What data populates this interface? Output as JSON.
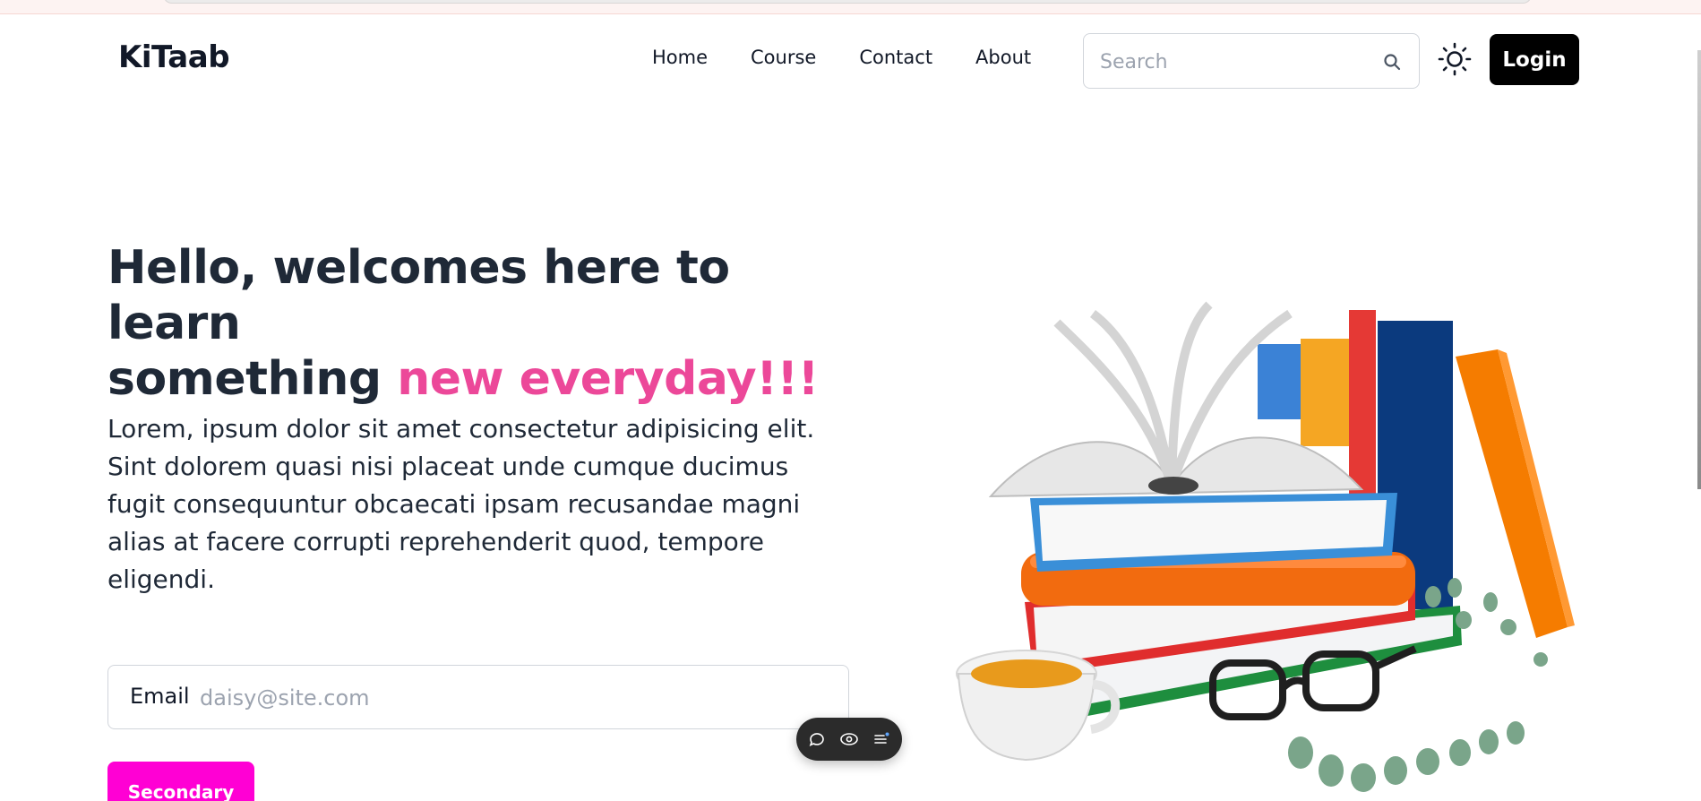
{
  "brand": {
    "name": "KiTaab"
  },
  "nav": {
    "links": [
      {
        "label": "Home"
      },
      {
        "label": "Course"
      },
      {
        "label": "Contact"
      },
      {
        "label": "About"
      }
    ],
    "search": {
      "placeholder": "Search",
      "icon": "search-icon"
    },
    "theme_icon": "sun-icon",
    "login_label": "Login"
  },
  "hero": {
    "title_line1": "Hello, welcomes here to learn",
    "title_line2_plain": "something ",
    "title_line2_accent": "new everyday!!!",
    "body": "Lorem, ipsum dolor sit amet consectetur adipisicing elit. Sint dolorem quasi nisi placeat unde cumque ducimus fugit consequuntur obcaecati ipsam recusandae magni alias at facere corrupti reprehenderit quod, tempore eligendi.",
    "email_label": "Email",
    "email_placeholder": "daisy@site.com",
    "secondary_label": "Secondary"
  },
  "floating_toolbar": {
    "icons": [
      "comment-icon",
      "eye-icon",
      "list-icon"
    ]
  },
  "colors": {
    "accent_pink": "#ec4899",
    "secondary_magenta": "#ff00d4",
    "login_bg": "#000000",
    "text_dark": "#1f2937"
  },
  "illustration": {
    "icon": "books-stack-illustration"
  }
}
